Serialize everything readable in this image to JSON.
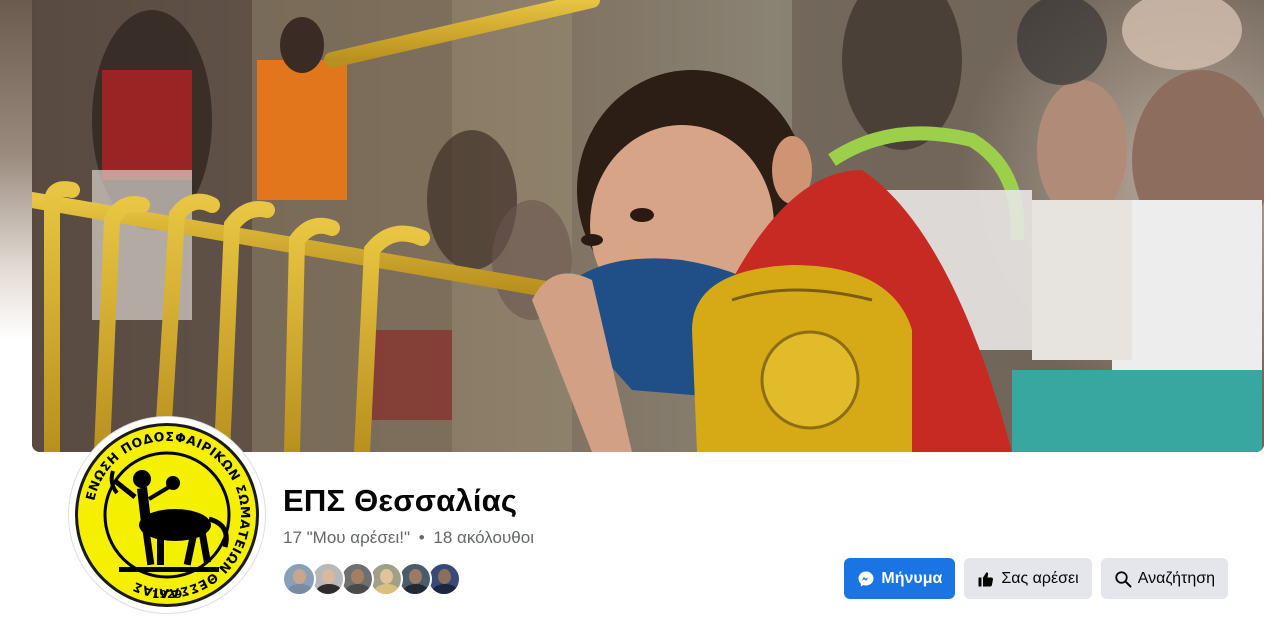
{
  "page": {
    "title": "ΕΠΣ Θεσσαλίας",
    "likes_text": "17 \"Μου αρέσει!\"",
    "separator": "•",
    "followers_text": "18 ακόλουθοι"
  },
  "logo": {
    "ring_text": "ΕΝΩΣΗ ΠΟΔΟΣΦΑΙΡΙΚΩΝ ΣΩΜΑΤΕΙΩΝ ΘΕΣΣΑΛΙΑΣ",
    "year": "1929",
    "fill_color": "#f4f000"
  },
  "followers": [
    {
      "name": "follower-1",
      "skin": "#c9a58c",
      "shirt": "#7a8aa0",
      "bg": "#8aa0b8"
    },
    {
      "name": "follower-2",
      "skin": "#d7b9a0",
      "shirt": "#2d2d2d",
      "bg": "#b8b8b8"
    },
    {
      "name": "follower-3",
      "skin": "#a57d63",
      "shirt": "#4a4a4a",
      "bg": "#6f6f6f"
    },
    {
      "name": "follower-4",
      "skin": "#e0c29c",
      "shirt": "#d8c080",
      "bg": "#a0a088"
    },
    {
      "name": "follower-5",
      "skin": "#9a7b66",
      "shirt": "#1f2a36",
      "bg": "#4c5b6a"
    },
    {
      "name": "follower-6",
      "skin": "#8c6e5c",
      "shirt": "#1c2540",
      "bg": "#3a4a78"
    }
  ],
  "actions": {
    "message_label": "Μήνυμα",
    "like_label": "Σας αρέσει",
    "search_label": "Αναζήτηση"
  },
  "colors": {
    "primary": "#1b74e4",
    "secondary_button": "#e4e6eb",
    "text_muted": "#65676b"
  }
}
